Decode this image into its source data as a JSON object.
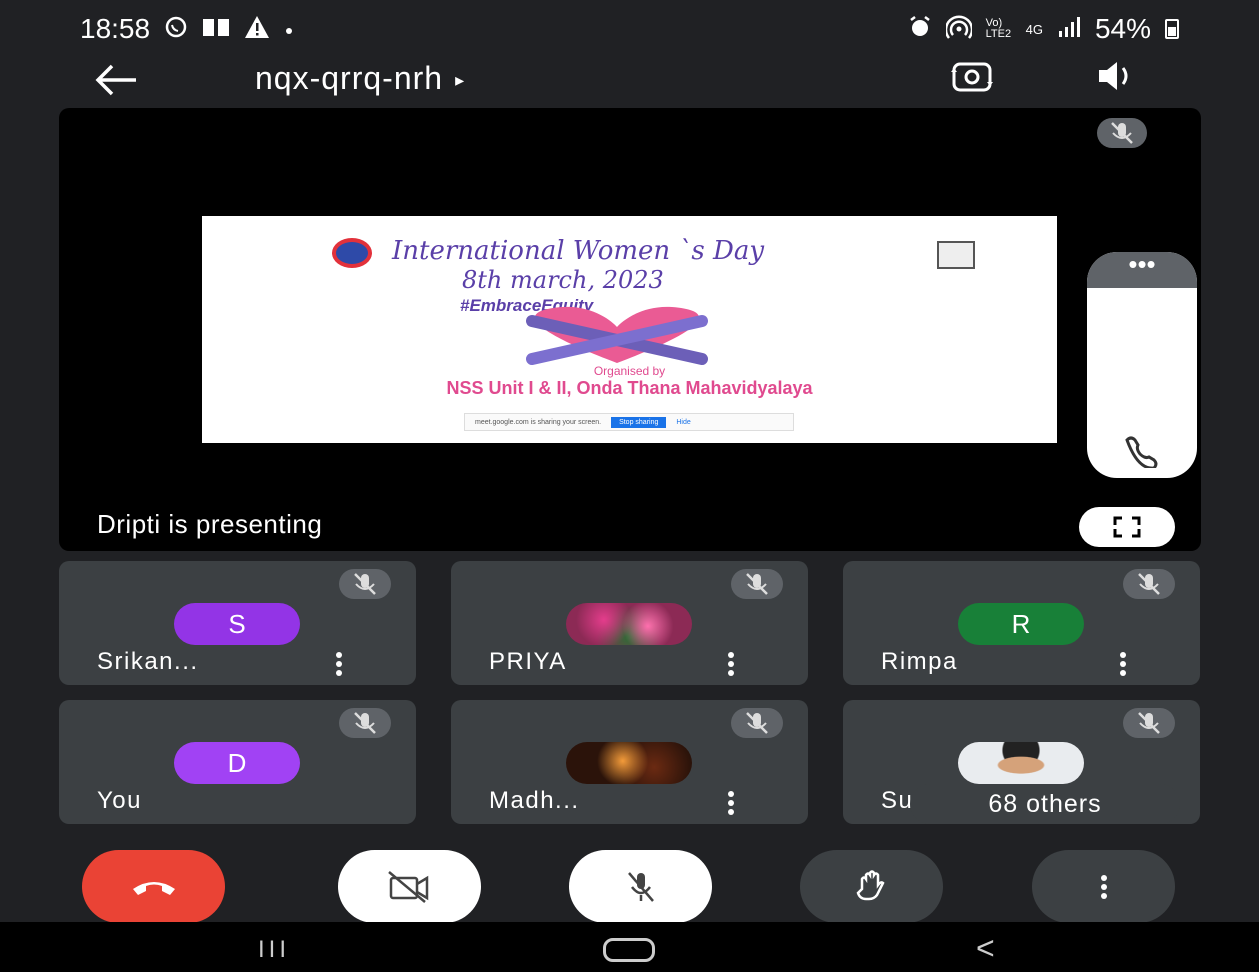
{
  "status_bar": {
    "time": "18:58",
    "left_icons": [
      "whatsapp-icon",
      "book-icon",
      "warning-icon",
      "dot-icon"
    ],
    "right_icons": [
      "alarm-icon",
      "hotspot-icon",
      "volte-icon",
      "4g-icon",
      "signal-icon"
    ],
    "volte_text": "Vo) LTE2",
    "network_text": "4G",
    "battery": "54%"
  },
  "header": {
    "meeting_code": "nqx-qrrq-nrh",
    "code_arrow": "▸"
  },
  "presentation": {
    "presenting_text": "Dripti is presenting",
    "slide": {
      "title": "International Women `s Day",
      "date": "8th march, 2023",
      "hashtag": "#EmbraceEquity",
      "organised_label": "Organised by",
      "organiser": "NSS Unit I & II, Onda Thana Mahavidyalaya",
      "share_banner_text": "meet.google.com is sharing your screen.",
      "share_stop": "Stop sharing",
      "share_hide": "Hide"
    }
  },
  "side_panel": {
    "dots": "•••"
  },
  "participants": [
    {
      "initial": "S",
      "name": "Srikan...",
      "avatar_color": "#9334e6",
      "has_menu": true
    },
    {
      "initial": "",
      "name": "PRIYA",
      "avatar_color": "",
      "has_menu": true
    },
    {
      "initial": "R",
      "name": "Rimpa",
      "avatar_color": "#188038",
      "has_menu": true
    },
    {
      "initial": "D",
      "name": "You",
      "avatar_color": "#a142f4",
      "has_menu": false
    },
    {
      "initial": "",
      "name": "Madh...",
      "avatar_color": "",
      "has_menu": true
    },
    {
      "initial": "",
      "name": "Su",
      "avatar_color": "",
      "has_menu": false
    }
  ],
  "others_badge": "68 others",
  "controls": [
    "end-call",
    "camera-off",
    "mic-off",
    "raise-hand",
    "more-options"
  ],
  "colors": {
    "background": "#202124",
    "tile": "#3c4043",
    "end_call": "#ea4335",
    "slide_accent": "#e04a8f",
    "slide_title": "#5a3fa8"
  },
  "nav": {
    "recents": "III",
    "back": "<"
  }
}
